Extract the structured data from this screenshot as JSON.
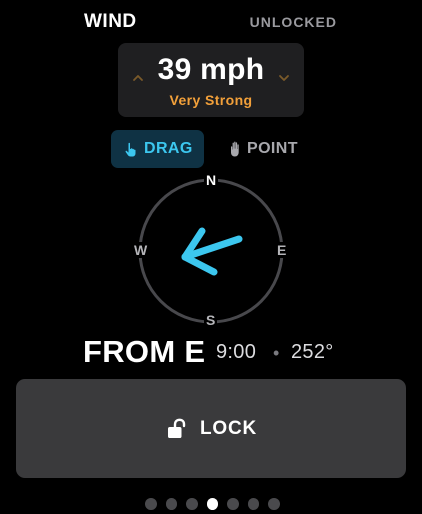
{
  "header": {
    "title": "WIND",
    "status": "UNLOCKED"
  },
  "speed": {
    "value": "39 mph",
    "description": "Very Strong",
    "up_icon": "chevron-up-icon",
    "down_icon": "chevron-down-icon"
  },
  "modes": {
    "drag": {
      "label": "DRAG",
      "icon": "tap-hand-icon",
      "selected": true
    },
    "point": {
      "label": "POINT",
      "icon": "raised-hand-icon",
      "selected": false
    }
  },
  "compass": {
    "north": "N",
    "east": "E",
    "south": "S",
    "west": "W",
    "arrow_icon": "wind-direction-arrow-icon"
  },
  "readout": {
    "from": "FROM E",
    "time": "9:00",
    "separator": "•",
    "bearing": "252°"
  },
  "lock": {
    "label": "LOCK",
    "icon": "unlocked-padlock-icon"
  },
  "pagination": {
    "total": 7,
    "current": 4
  },
  "colors": {
    "background": "#000000",
    "accent": "#3cc7ef",
    "warning": "#f2a03a",
    "card": "#1f1f21",
    "button": "#3a3a3c",
    "muted": "#9a9a9f"
  }
}
